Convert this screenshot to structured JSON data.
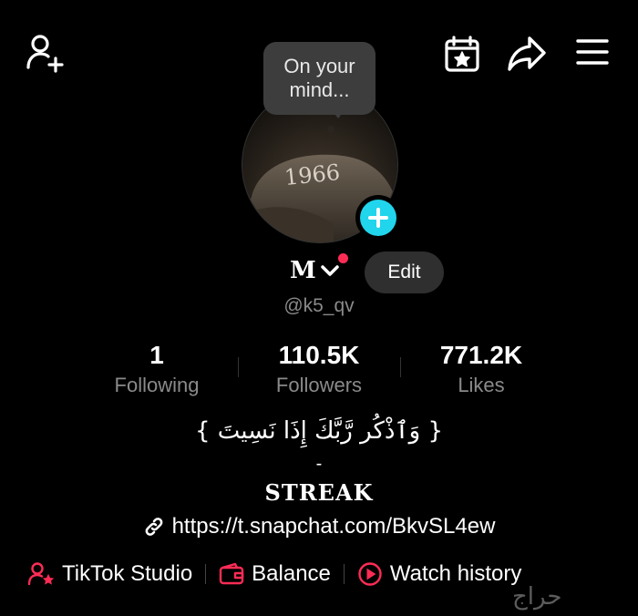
{
  "header": {
    "add_friend_icon": "person-plus-icon",
    "calendar_icon": "calendar-star-icon",
    "share_icon": "share-arrow-icon",
    "menu_icon": "hamburger-menu-icon"
  },
  "profile": {
    "bubble_text": "On your mind...",
    "avatar_text": "1966",
    "display_name": "M",
    "edit_label": "Edit",
    "username": "@k5_qv"
  },
  "stats": [
    {
      "value": "1",
      "label": "Following"
    },
    {
      "value": "110.5K",
      "label": "Followers"
    },
    {
      "value": "771.2K",
      "label": "Likes"
    }
  ],
  "bio": {
    "arabic": "{ وَٱذْكُر رَّبَّكَ إِذَا نَسِيتَ }",
    "dash": "-",
    "streak": "STREAK"
  },
  "link": {
    "url": "https://t.snapchat.com/BkvSL4ew"
  },
  "bottom": {
    "studio_label": "TikTok Studio",
    "balance_label": "Balance",
    "history_label": "Watch history"
  },
  "watermark": "حراج",
  "colors": {
    "accent_red": "#fe2c55",
    "accent_cyan": "#20d5ec"
  }
}
